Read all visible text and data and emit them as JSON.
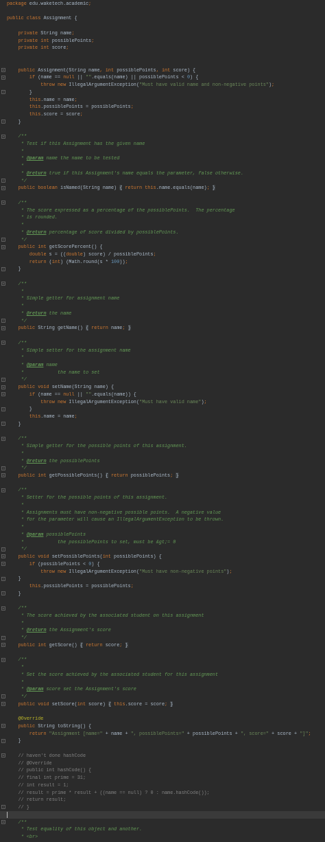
{
  "editor": {
    "lines": [
      {
        "kind": "line",
        "current": false,
        "tokens": [
          {
            "kind": "kw",
            "text": "package"
          },
          {
            "kind": "plain",
            "text": " edu.waketech.academic"
          },
          {
            "kind": "kw",
            "text": ";"
          }
        ]
      },
      {
        "kind": "line",
        "current": false
      },
      {
        "kind": "line",
        "current": false,
        "tokens": [
          {
            "kind": "kw",
            "text": "public class"
          },
          {
            "kind": "plain",
            "text": " Assignment {"
          }
        ]
      },
      {
        "kind": "line",
        "current": false
      },
      {
        "kind": "line",
        "current": false,
        "tokens": [
          {
            "kind": "kw",
            "text": "    private"
          },
          {
            "kind": "plain",
            "text": " String name"
          },
          {
            "kind": "kw",
            "text": ";"
          }
        ]
      },
      {
        "kind": "line",
        "current": false,
        "tokens": [
          {
            "kind": "kw",
            "text": "    private int"
          },
          {
            "kind": "plain",
            "text": " possiblePoints"
          },
          {
            "kind": "kw",
            "text": ";"
          }
        ]
      },
      {
        "kind": "line",
        "current": false,
        "tokens": [
          {
            "kind": "kw",
            "text": "    private int"
          },
          {
            "kind": "plain",
            "text": " score"
          },
          {
            "kind": "kw",
            "text": ";"
          }
        ]
      },
      {
        "kind": "line",
        "current": false
      },
      {
        "kind": "line",
        "current": false
      },
      {
        "kind": "fold_start",
        "current": false,
        "tokens": [
          {
            "kind": "kw",
            "text": "    public"
          },
          {
            "kind": "plain",
            "text": " Assignment(String name"
          },
          {
            "kind": "kw",
            "text": ", int"
          },
          {
            "kind": "plain",
            "text": " possiblePoints"
          },
          {
            "kind": "kw",
            "text": ", int"
          },
          {
            "kind": "plain",
            "text": " score) {"
          }
        ]
      },
      {
        "kind": "fold_start",
        "current": false,
        "tokens": [
          {
            "kind": "kw",
            "text": "        if"
          },
          {
            "kind": "plain",
            "text": " (name == "
          },
          {
            "kind": "kw",
            "text": "null"
          },
          {
            "kind": "plain",
            "text": " || "
          },
          {
            "kind": "str",
            "text": "\"\""
          },
          {
            "kind": "plain",
            "text": ".equals(name) || possiblePoints < "
          },
          {
            "kind": "num",
            "text": "0"
          },
          {
            "kind": "plain",
            "text": ") {"
          }
        ]
      },
      {
        "kind": "line",
        "current": false,
        "tokens": [
          {
            "kind": "kw",
            "text": "            throw new"
          },
          {
            "kind": "plain",
            "text": " IllegalArgumentException("
          },
          {
            "kind": "str",
            "text": "\"Must have valid name and non-negative points\""
          },
          {
            "kind": "plain",
            "text": ")"
          },
          {
            "kind": "kw",
            "text": ";"
          }
        ]
      },
      {
        "kind": "fold_end",
        "current": false,
        "tokens": [
          {
            "kind": "plain",
            "text": "        }"
          }
        ]
      },
      {
        "kind": "line",
        "current": false,
        "tokens": [
          {
            "kind": "kw",
            "text": "        this"
          },
          {
            "kind": "plain",
            "text": ".name = name"
          },
          {
            "kind": "kw",
            "text": ";"
          }
        ]
      },
      {
        "kind": "line",
        "current": false,
        "tokens": [
          {
            "kind": "kw",
            "text": "        this"
          },
          {
            "kind": "plain",
            "text": ".possiblePoints = possiblePoints"
          },
          {
            "kind": "kw",
            "text": ";"
          }
        ]
      },
      {
        "kind": "line",
        "current": false,
        "tokens": [
          {
            "kind": "kw",
            "text": "        this"
          },
          {
            "kind": "plain",
            "text": ".score = score"
          },
          {
            "kind": "kw",
            "text": ";"
          }
        ]
      },
      {
        "kind": "fold_end",
        "current": false,
        "tokens": [
          {
            "kind": "plain",
            "text": "    }"
          }
        ]
      },
      {
        "kind": "line",
        "current": false
      },
      {
        "kind": "fold_start",
        "current": false,
        "tokens": [
          {
            "kind": "doc",
            "text": "    /**"
          }
        ]
      },
      {
        "kind": "line",
        "current": false,
        "tokens": [
          {
            "kind": "doc",
            "text": "     * Test if this Assignment has the given name"
          }
        ]
      },
      {
        "kind": "line",
        "current": false,
        "tokens": [
          {
            "kind": "doc",
            "text": "     *"
          }
        ]
      },
      {
        "kind": "line",
        "current": false,
        "tokens": [
          {
            "kind": "doc",
            "text": "     * "
          },
          {
            "kind": "tag",
            "text": "@param"
          },
          {
            "kind": "doc",
            "text": " name the name to be tested"
          }
        ]
      },
      {
        "kind": "line",
        "current": false,
        "tokens": [
          {
            "kind": "doc",
            "text": "     *"
          }
        ]
      },
      {
        "kind": "line",
        "current": false,
        "tokens": [
          {
            "kind": "doc",
            "text": "     * "
          },
          {
            "kind": "tag",
            "text": "@return"
          },
          {
            "kind": "doc",
            "text": " true if this Assignment's name equals the parameter, false otherwise."
          }
        ]
      },
      {
        "kind": "fold_end",
        "current": false,
        "tokens": [
          {
            "kind": "doc",
            "text": "     */"
          }
        ]
      },
      {
        "kind": "fold_start",
        "current": false,
        "tokens": [
          {
            "kind": "kw",
            "text": "    public boolean"
          },
          {
            "kind": "plain",
            "text": " isNamed(String name) "
          },
          {
            "kind": "fold",
            "text": "{"
          },
          {
            "kind": "kw",
            "text": " return this"
          },
          {
            "kind": "plain",
            "text": ".name.equals(name)"
          },
          {
            "kind": "kw",
            "text": "; "
          },
          {
            "kind": "fold",
            "text": "}"
          }
        ]
      },
      {
        "kind": "line",
        "current": false
      },
      {
        "kind": "fold_start",
        "current": false,
        "tokens": [
          {
            "kind": "doc",
            "text": "    /**"
          }
        ]
      },
      {
        "kind": "line",
        "current": false,
        "tokens": [
          {
            "kind": "doc",
            "text": "     * The score expressed as a percentage of the possiblePoints.  The percentage"
          }
        ]
      },
      {
        "kind": "line",
        "current": false,
        "tokens": [
          {
            "kind": "doc",
            "text": "     * is rounded."
          }
        ]
      },
      {
        "kind": "line",
        "current": false,
        "tokens": [
          {
            "kind": "doc",
            "text": "     *"
          }
        ]
      },
      {
        "kind": "line",
        "current": false,
        "tokens": [
          {
            "kind": "doc",
            "text": "     * "
          },
          {
            "kind": "tag",
            "text": "@return"
          },
          {
            "kind": "doc",
            "text": " percentage of score divided by possiblePoints."
          }
        ]
      },
      {
        "kind": "fold_end",
        "current": false,
        "tokens": [
          {
            "kind": "doc",
            "text": "     */"
          }
        ]
      },
      {
        "kind": "fold_start",
        "current": false,
        "tokens": [
          {
            "kind": "kw",
            "text": "    public int"
          },
          {
            "kind": "plain",
            "text": " getScorePercent() {"
          }
        ]
      },
      {
        "kind": "line",
        "current": false,
        "tokens": [
          {
            "kind": "kw",
            "text": "        double"
          },
          {
            "kind": "plain",
            "text": " s = (("
          },
          {
            "kind": "kw",
            "text": "double"
          },
          {
            "kind": "plain",
            "text": ") score) / possiblePoints"
          },
          {
            "kind": "kw",
            "text": ";"
          }
        ]
      },
      {
        "kind": "line",
        "current": false,
        "tokens": [
          {
            "kind": "kw",
            "text": "        return"
          },
          {
            "kind": "plain",
            "text": " ("
          },
          {
            "kind": "kw",
            "text": "int"
          },
          {
            "kind": "plain",
            "text": ") (Math.round(s * "
          },
          {
            "kind": "num",
            "text": "100"
          },
          {
            "kind": "plain",
            "text": "))"
          },
          {
            "kind": "kw",
            "text": ";"
          }
        ]
      },
      {
        "kind": "fold_end",
        "current": false,
        "tokens": [
          {
            "kind": "plain",
            "text": "    }"
          }
        ]
      },
      {
        "kind": "line",
        "current": false
      },
      {
        "kind": "fold_start",
        "current": false,
        "tokens": [
          {
            "kind": "doc",
            "text": "    /**"
          }
        ]
      },
      {
        "kind": "line",
        "current": false,
        "tokens": [
          {
            "kind": "doc",
            "text": "     *"
          }
        ]
      },
      {
        "kind": "line",
        "current": false,
        "tokens": [
          {
            "kind": "doc",
            "text": "     * Simple getter for assignment name"
          }
        ]
      },
      {
        "kind": "line",
        "current": false,
        "tokens": [
          {
            "kind": "doc",
            "text": "     *"
          }
        ]
      },
      {
        "kind": "line",
        "current": false,
        "tokens": [
          {
            "kind": "doc",
            "text": "     * "
          },
          {
            "kind": "tag",
            "text": "@return"
          },
          {
            "kind": "doc",
            "text": " the name"
          }
        ]
      },
      {
        "kind": "fold_end",
        "current": false,
        "tokens": [
          {
            "kind": "doc",
            "text": "     */"
          }
        ]
      },
      {
        "kind": "fold_start",
        "current": false,
        "tokens": [
          {
            "kind": "kw",
            "text": "    public"
          },
          {
            "kind": "plain",
            "text": " String getName() "
          },
          {
            "kind": "fold",
            "text": "{"
          },
          {
            "kind": "kw",
            "text": " return"
          },
          {
            "kind": "plain",
            "text": " name"
          },
          {
            "kind": "kw",
            "text": "; "
          },
          {
            "kind": "fold",
            "text": "}"
          }
        ]
      },
      {
        "kind": "line",
        "current": false
      },
      {
        "kind": "fold_start",
        "current": false,
        "tokens": [
          {
            "kind": "doc",
            "text": "    /**"
          }
        ]
      },
      {
        "kind": "line",
        "current": false,
        "tokens": [
          {
            "kind": "doc",
            "text": "     * Simple setter for the assignment name"
          }
        ]
      },
      {
        "kind": "line",
        "current": false,
        "tokens": [
          {
            "kind": "doc",
            "text": "     *"
          }
        ]
      },
      {
        "kind": "line",
        "current": false,
        "tokens": [
          {
            "kind": "doc",
            "text": "     * "
          },
          {
            "kind": "tag",
            "text": "@param"
          },
          {
            "kind": "doc",
            "text": " name"
          }
        ]
      },
      {
        "kind": "line",
        "current": false,
        "tokens": [
          {
            "kind": "doc",
            "text": "     *            the name to set"
          }
        ]
      },
      {
        "kind": "fold_end",
        "current": false,
        "tokens": [
          {
            "kind": "doc",
            "text": "     */"
          }
        ]
      },
      {
        "kind": "fold_start",
        "current": false,
        "tokens": [
          {
            "kind": "kw",
            "text": "    public void"
          },
          {
            "kind": "plain",
            "text": " setName(String name) {"
          }
        ]
      },
      {
        "kind": "fold_start",
        "current": false,
        "tokens": [
          {
            "kind": "kw",
            "text": "        if"
          },
          {
            "kind": "plain",
            "text": " (name == "
          },
          {
            "kind": "kw",
            "text": "null"
          },
          {
            "kind": "plain",
            "text": " || "
          },
          {
            "kind": "str",
            "text": "\"\""
          },
          {
            "kind": "plain",
            "text": ".equals(name)) {"
          }
        ]
      },
      {
        "kind": "line",
        "current": false,
        "tokens": [
          {
            "kind": "kw",
            "text": "            throw new"
          },
          {
            "kind": "plain",
            "text": " IllegalArgumentException("
          },
          {
            "kind": "str",
            "text": "\"Must have valid name\""
          },
          {
            "kind": "plain",
            "text": ")"
          },
          {
            "kind": "kw",
            "text": ";"
          }
        ]
      },
      {
        "kind": "fold_end",
        "current": false,
        "tokens": [
          {
            "kind": "plain",
            "text": "        }"
          }
        ]
      },
      {
        "kind": "line",
        "current": false,
        "tokens": [
          {
            "kind": "kw",
            "text": "        this"
          },
          {
            "kind": "plain",
            "text": ".name = name"
          },
          {
            "kind": "kw",
            "text": ";"
          }
        ]
      },
      {
        "kind": "fold_end",
        "current": false,
        "tokens": [
          {
            "kind": "plain",
            "text": "    }"
          }
        ]
      },
      {
        "kind": "line",
        "current": false
      },
      {
        "kind": "fold_start",
        "current": false,
        "tokens": [
          {
            "kind": "doc",
            "text": "    /**"
          }
        ]
      },
      {
        "kind": "line",
        "current": false,
        "tokens": [
          {
            "kind": "doc",
            "text": "     * Simple getter for the possible points of this assignment."
          }
        ]
      },
      {
        "kind": "line",
        "current": false,
        "tokens": [
          {
            "kind": "doc",
            "text": "     *"
          }
        ]
      },
      {
        "kind": "line",
        "current": false,
        "tokens": [
          {
            "kind": "doc",
            "text": "     * "
          },
          {
            "kind": "tag",
            "text": "@return"
          },
          {
            "kind": "doc",
            "text": " the possiblePoints"
          }
        ]
      },
      {
        "kind": "fold_end",
        "current": false,
        "tokens": [
          {
            "kind": "doc",
            "text": "     */"
          }
        ]
      },
      {
        "kind": "fold_start",
        "current": false,
        "tokens": [
          {
            "kind": "kw",
            "text": "    public int"
          },
          {
            "kind": "plain",
            "text": " getPossiblePoints() "
          },
          {
            "kind": "fold",
            "text": "{"
          },
          {
            "kind": "kw",
            "text": " return"
          },
          {
            "kind": "plain",
            "text": " possiblePoints"
          },
          {
            "kind": "kw",
            "text": "; "
          },
          {
            "kind": "fold",
            "text": "}"
          }
        ]
      },
      {
        "kind": "line",
        "current": false
      },
      {
        "kind": "fold_start",
        "current": false,
        "tokens": [
          {
            "kind": "doc",
            "text": "    /**"
          }
        ]
      },
      {
        "kind": "line",
        "current": false,
        "tokens": [
          {
            "kind": "doc",
            "text": "     * Setter for the possible points of this assignment."
          }
        ]
      },
      {
        "kind": "line",
        "current": false,
        "tokens": [
          {
            "kind": "doc",
            "text": "     *"
          }
        ]
      },
      {
        "kind": "line",
        "current": false,
        "tokens": [
          {
            "kind": "doc",
            "text": "     * Assignments must have non-negative possible points.  A negative value"
          }
        ]
      },
      {
        "kind": "line",
        "current": false,
        "tokens": [
          {
            "kind": "doc",
            "text": "     * for the parameter will cause an IllegalArgumentException to be thrown."
          }
        ]
      },
      {
        "kind": "line",
        "current": false,
        "tokens": [
          {
            "kind": "doc",
            "text": "     *"
          }
        ]
      },
      {
        "kind": "line",
        "current": false,
        "tokens": [
          {
            "kind": "doc",
            "text": "     * "
          },
          {
            "kind": "tag",
            "text": "@param"
          },
          {
            "kind": "doc",
            "text": " possiblePoints"
          }
        ]
      },
      {
        "kind": "line",
        "current": false,
        "tokens": [
          {
            "kind": "doc",
            "text": "     *            the possiblePoints to set, must be &gt;= 0"
          }
        ]
      },
      {
        "kind": "fold_end",
        "current": false,
        "tokens": [
          {
            "kind": "doc",
            "text": "     */"
          }
        ]
      },
      {
        "kind": "fold_start",
        "current": false,
        "tokens": [
          {
            "kind": "kw",
            "text": "    public void"
          },
          {
            "kind": "plain",
            "text": " setPossiblePoints("
          },
          {
            "kind": "kw",
            "text": "int"
          },
          {
            "kind": "plain",
            "text": " possiblePoints) {"
          }
        ]
      },
      {
        "kind": "fold_start",
        "current": false,
        "tokens": [
          {
            "kind": "kw",
            "text": "        if"
          },
          {
            "kind": "plain",
            "text": " (possiblePoints < "
          },
          {
            "kind": "num",
            "text": "0"
          },
          {
            "kind": "plain",
            "text": ") {"
          }
        ]
      },
      {
        "kind": "line",
        "current": false,
        "tokens": [
          {
            "kind": "kw",
            "text": "            throw new"
          },
          {
            "kind": "plain",
            "text": " IllegalArgumentException("
          },
          {
            "kind": "str",
            "text": "\"Must have non-negative points\""
          },
          {
            "kind": "plain",
            "text": ")"
          },
          {
            "kind": "kw",
            "text": ";"
          }
        ]
      },
      {
        "kind": "fold_end",
        "current": false,
        "tokens": [
          {
            "kind": "plain",
            "text": "    }"
          }
        ]
      },
      {
        "kind": "line",
        "current": false,
        "tokens": [
          {
            "kind": "kw",
            "text": "        this"
          },
          {
            "kind": "plain",
            "text": ".possiblePoints = possiblePoints"
          },
          {
            "kind": "kw",
            "text": ";"
          }
        ]
      },
      {
        "kind": "fold_end",
        "current": false,
        "tokens": [
          {
            "kind": "plain",
            "text": "    }"
          }
        ]
      },
      {
        "kind": "line",
        "current": false
      },
      {
        "kind": "fold_start",
        "current": false,
        "tokens": [
          {
            "kind": "doc",
            "text": "    /**"
          }
        ]
      },
      {
        "kind": "line",
        "current": false,
        "tokens": [
          {
            "kind": "doc",
            "text": "     * The score achieved by the associated student on this assignment"
          }
        ]
      },
      {
        "kind": "line",
        "current": false,
        "tokens": [
          {
            "kind": "doc",
            "text": "     *"
          }
        ]
      },
      {
        "kind": "line",
        "current": false,
        "tokens": [
          {
            "kind": "doc",
            "text": "     * "
          },
          {
            "kind": "tag",
            "text": "@return"
          },
          {
            "kind": "doc",
            "text": " the Assignment's score"
          }
        ]
      },
      {
        "kind": "fold_end",
        "current": false,
        "tokens": [
          {
            "kind": "doc",
            "text": "     */"
          }
        ]
      },
      {
        "kind": "fold_start",
        "current": false,
        "tokens": [
          {
            "kind": "kw",
            "text": "    public int"
          },
          {
            "kind": "plain",
            "text": " getScore() "
          },
          {
            "kind": "fold",
            "text": "{"
          },
          {
            "kind": "kw",
            "text": " return"
          },
          {
            "kind": "plain",
            "text": " score"
          },
          {
            "kind": "kw",
            "text": "; "
          },
          {
            "kind": "fold",
            "text": "}"
          }
        ]
      },
      {
        "kind": "line",
        "current": false
      },
      {
        "kind": "fold_start",
        "current": false,
        "tokens": [
          {
            "kind": "doc",
            "text": "    /**"
          }
        ]
      },
      {
        "kind": "line",
        "current": false,
        "tokens": [
          {
            "kind": "doc",
            "text": "     *"
          }
        ]
      },
      {
        "kind": "line",
        "current": false,
        "tokens": [
          {
            "kind": "doc",
            "text": "     * Set the score achieved by the associated student for this assignment"
          }
        ]
      },
      {
        "kind": "line",
        "current": false,
        "tokens": [
          {
            "kind": "doc",
            "text": "     *"
          }
        ]
      },
      {
        "kind": "line",
        "current": false,
        "tokens": [
          {
            "kind": "doc",
            "text": "     * "
          },
          {
            "kind": "tag",
            "text": "@param"
          },
          {
            "kind": "doc",
            "text": " score set the Assignment's score"
          }
        ]
      },
      {
        "kind": "fold_end",
        "current": false,
        "tokens": [
          {
            "kind": "doc",
            "text": "     */"
          }
        ]
      },
      {
        "kind": "fold_start",
        "current": false,
        "tokens": [
          {
            "kind": "kw",
            "text": "    public void"
          },
          {
            "kind": "plain",
            "text": " setScore("
          },
          {
            "kind": "kw",
            "text": "int"
          },
          {
            "kind": "plain",
            "text": " score) "
          },
          {
            "kind": "fold",
            "text": "{"
          },
          {
            "kind": "kw",
            "text": " this"
          },
          {
            "kind": "plain",
            "text": ".score = score"
          },
          {
            "kind": "kw",
            "text": "; "
          },
          {
            "kind": "fold",
            "text": "}"
          }
        ]
      },
      {
        "kind": "line",
        "current": false
      },
      {
        "kind": "line",
        "current": false,
        "tokens": [
          {
            "kind": "ann",
            "text": "    @Override"
          }
        ]
      },
      {
        "kind": "fold_start",
        "current": false,
        "tokens": [
          {
            "kind": "kw",
            "text": "    public"
          },
          {
            "kind": "plain",
            "text": " String toString() {"
          }
        ]
      },
      {
        "kind": "line",
        "current": false,
        "tokens": [
          {
            "kind": "kw",
            "text": "        return"
          },
          {
            "kind": "str",
            "text": " \"Assignment [name=\""
          },
          {
            "kind": "plain",
            "text": " + name + "
          },
          {
            "kind": "str",
            "text": "\", possiblePoints=\""
          },
          {
            "kind": "plain",
            "text": " + possiblePoints + "
          },
          {
            "kind": "str",
            "text": "\", score=\""
          },
          {
            "kind": "plain",
            "text": " + score + "
          },
          {
            "kind": "str",
            "text": "\"]\""
          },
          {
            "kind": "kw",
            "text": ";"
          }
        ]
      },
      {
        "kind": "fold_end",
        "current": false,
        "tokens": [
          {
            "kind": "plain",
            "text": "    }"
          }
        ]
      },
      {
        "kind": "line",
        "current": false
      },
      {
        "kind": "fold_start",
        "current": false,
        "tokens": [
          {
            "kind": "cmt",
            "text": "    // haven't done hashCode"
          }
        ]
      },
      {
        "kind": "line",
        "current": false,
        "tokens": [
          {
            "kind": "cmt",
            "text": "    // @Override"
          }
        ]
      },
      {
        "kind": "line",
        "current": false,
        "tokens": [
          {
            "kind": "cmt",
            "text": "    // public int hashCode() {"
          }
        ]
      },
      {
        "kind": "line",
        "current": false,
        "tokens": [
          {
            "kind": "cmt",
            "text": "    // final int prime = 31;"
          }
        ]
      },
      {
        "kind": "line",
        "current": false,
        "tokens": [
          {
            "kind": "cmt",
            "text": "    // int result = 1;"
          }
        ]
      },
      {
        "kind": "line",
        "current": false,
        "tokens": [
          {
            "kind": "cmt",
            "text": "    // result = prime * result + ((name == null) ? 0 : name.hashCode());"
          }
        ]
      },
      {
        "kind": "line",
        "current": false,
        "tokens": [
          {
            "kind": "cmt",
            "text": "    // return result;"
          }
        ]
      },
      {
        "kind": "fold_end",
        "current": false,
        "tokens": [
          {
            "kind": "cmt",
            "text": "    // }"
          }
        ]
      },
      {
        "kind": "line",
        "current": true
      },
      {
        "kind": "fold_start",
        "current": false,
        "tokens": [
          {
            "kind": "doc",
            "text": "    /**"
          }
        ]
      },
      {
        "kind": "line",
        "current": false,
        "tokens": [
          {
            "kind": "doc",
            "text": "     * Test equality of this object and another."
          }
        ]
      },
      {
        "kind": "line",
        "current": false,
        "tokens": [
          {
            "kind": "doc",
            "text": "     * <br>"
          }
        ]
      }
    ]
  }
}
